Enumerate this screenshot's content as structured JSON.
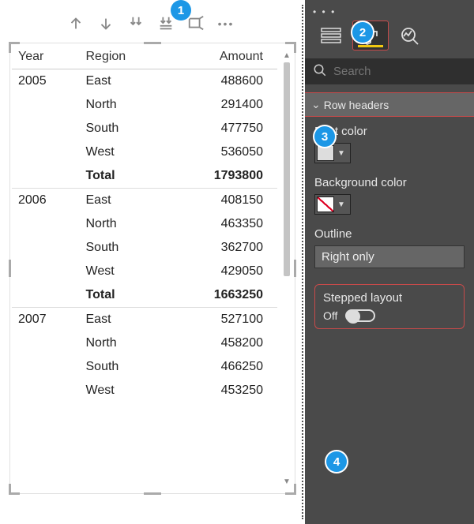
{
  "toolbar_icons": [
    "arrow-up",
    "arrow-down",
    "drill-down",
    "expand-down",
    "focus-mode",
    "more"
  ],
  "table": {
    "headers": [
      "Year",
      "Region",
      "Amount"
    ],
    "rows": [
      {
        "year": "2005",
        "region": "East",
        "amount": "488600",
        "sep": true
      },
      {
        "year": "",
        "region": "North",
        "amount": "291400"
      },
      {
        "year": "",
        "region": "South",
        "amount": "477750"
      },
      {
        "year": "",
        "region": "West",
        "amount": "536050"
      },
      {
        "year": "",
        "region": "Total",
        "amount": "1793800",
        "total": true
      },
      {
        "year": "2006",
        "region": "East",
        "amount": "408150",
        "sep": true
      },
      {
        "year": "",
        "region": "North",
        "amount": "463350"
      },
      {
        "year": "",
        "region": "South",
        "amount": "362700"
      },
      {
        "year": "",
        "region": "West",
        "amount": "429050"
      },
      {
        "year": "",
        "region": "Total",
        "amount": "1663250",
        "total": true
      },
      {
        "year": "2007",
        "region": "East",
        "amount": "527100",
        "sep": true
      },
      {
        "year": "",
        "region": "North",
        "amount": "458200"
      },
      {
        "year": "",
        "region": "South",
        "amount": "466250"
      },
      {
        "year": "",
        "region": "West",
        "amount": "453250"
      }
    ]
  },
  "pane": {
    "search_placeholder": "Search",
    "section_title": "Row headers",
    "font_color_label": "Font color",
    "bg_color_label": "Background color",
    "outline_label": "Outline",
    "outline_value": "Right only",
    "stepped_label": "Stepped layout",
    "stepped_state": "Off"
  },
  "badges": {
    "b1": "1",
    "b2": "2",
    "b3": "3",
    "b4": "4"
  }
}
